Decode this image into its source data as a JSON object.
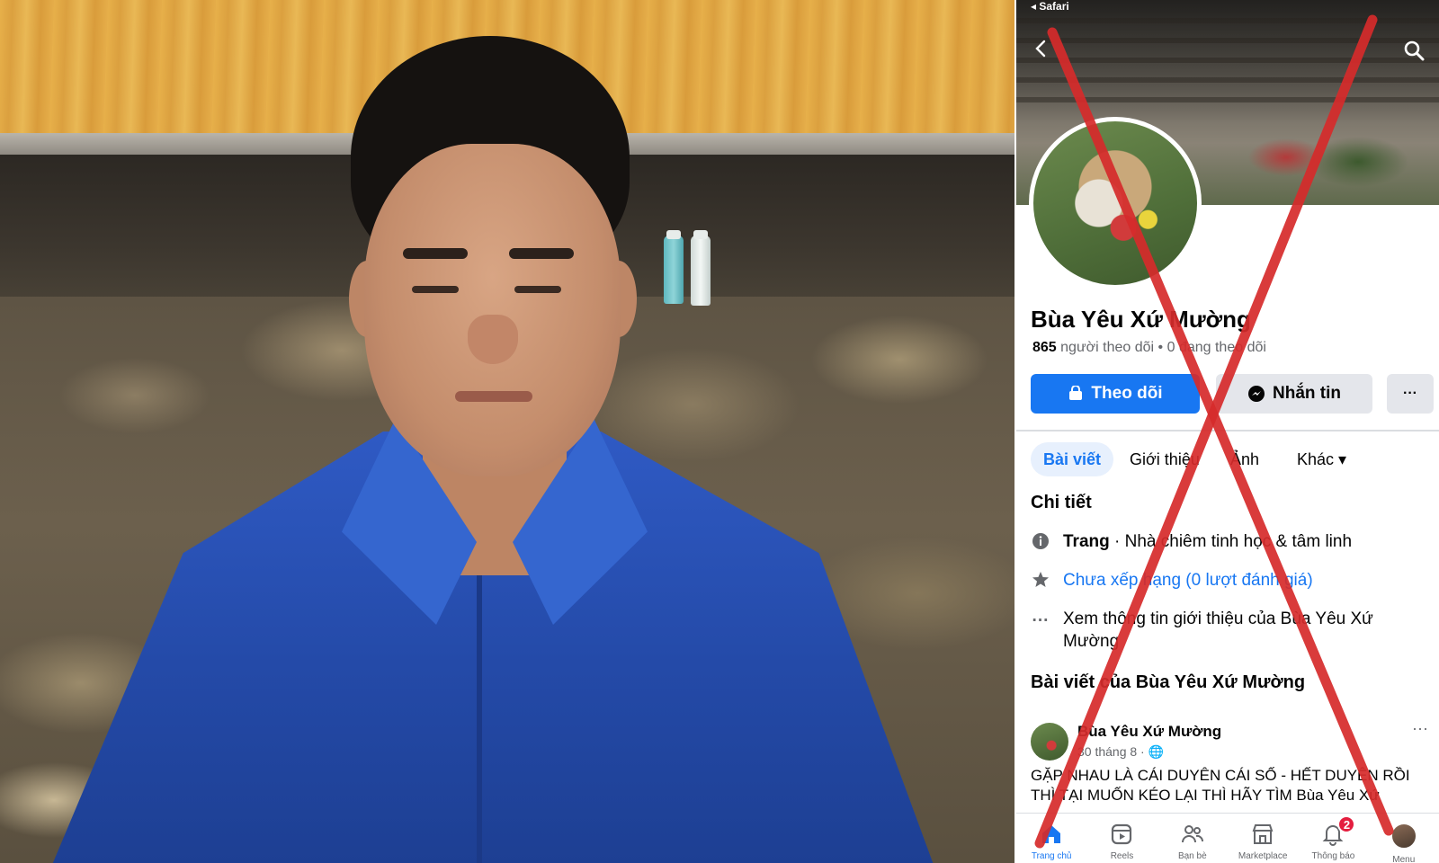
{
  "statusbar": {
    "back_app": "◂ Safari"
  },
  "profile": {
    "name": "Bùa Yêu Xứ Mường",
    "followers_count": "865",
    "followers_label": "người theo dõi",
    "following_text": "• 0 đang theo dõi"
  },
  "actions": {
    "follow": "Theo dõi",
    "message": "Nhắn tin",
    "more": "···"
  },
  "tabs": [
    {
      "label": "Bài viết",
      "active": true
    },
    {
      "label": "Giới thiệu"
    },
    {
      "label": "Ảnh"
    },
    {
      "label": "Khác ▾"
    }
  ],
  "details": {
    "title": "Chi tiết",
    "category_prefix": "Trang",
    "category": " · Nhà chiêm tinh học & tâm linh",
    "rating": "Chưa xếp hạng (0 lượt đánh giá)",
    "about": "Xem thông tin giới thiệu của Bùa Yêu Xứ Mường"
  },
  "posts": {
    "title": "Bài viết của Bùa Yêu Xứ Mường",
    "author": "Bùa Yêu Xứ Mường",
    "meta": "30 tháng 8 · 🌐",
    "more": "···",
    "text": "GẶP NHAU LÀ CÁI DUYÊN CÁI SỐ - HẾT DUYÊN RỒI THÌ TẠI MUỐN KÉO LẠI THÌ HÃY TÌM Bùa Yêu Xứ"
  },
  "bottom_nav": [
    {
      "label": "Trang chủ",
      "icon": "home-icon"
    },
    {
      "label": "Reels",
      "icon": "reels-icon"
    },
    {
      "label": "Bạn bè",
      "icon": "friends-icon"
    },
    {
      "label": "Marketplace",
      "icon": "marketplace-icon"
    },
    {
      "label": "Thông báo",
      "icon": "bell-icon",
      "badge": "2"
    },
    {
      "label": "Menu",
      "icon": "avatar"
    }
  ],
  "colors": {
    "fb_blue": "#1877f2",
    "cross_red": "#d62b2b"
  }
}
